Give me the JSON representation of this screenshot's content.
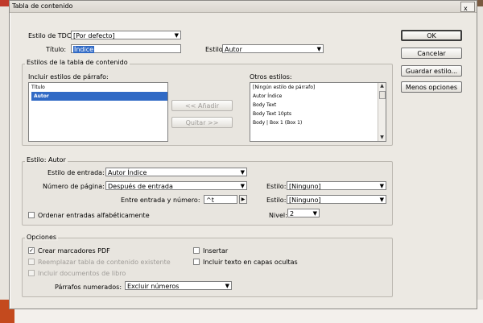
{
  "window": {
    "title": "Tabla de contenido",
    "close_glyph": "x"
  },
  "top": {
    "estilo_tdc_label": "Estilo de TDC:",
    "estilo_tdc_value": "[Por defecto]",
    "titulo_label": "Título:",
    "titulo_value": "Índice",
    "estilo_label": "Estilo:",
    "estilo_value": "Autor"
  },
  "buttons": {
    "ok": "OK",
    "cancel": "Cancelar",
    "save": "Guardar estilo...",
    "fewer": "Menos opciones",
    "add": "<< Añadir",
    "remove": "Quitar >>"
  },
  "estilos_group": {
    "title": "Estilos de la tabla de contenido",
    "incluir_label": "Incluir estilos de párrafo:",
    "incluir_items": [
      "Título",
      "Autor"
    ],
    "incluir_selected": "Autor",
    "otros_label": "Otros estilos:",
    "otros_items": [
      "[Ningún estilo de párrafo]",
      "Autor Índice",
      "Body Text",
      "Body Text 10pts",
      "Body | Box 1 (Box 1)"
    ]
  },
  "autor_group": {
    "title": "Estilo: Autor",
    "entrada_label": "Estilo de entrada:",
    "entrada_value": "Autor Índice",
    "pagina_label": "Número de página:",
    "pagina_value": "Después de entrada",
    "estilo1_label": "Estilo:",
    "estilo1_value": "[Ninguno]",
    "entre_label": "Entre entrada y número:",
    "entre_value": "^t",
    "estilo2_label": "Estilo:",
    "estilo2_value": "[Ninguno]",
    "ordenar_label": "Ordenar entradas alfabéticamente",
    "nivel_label": "Nivel:",
    "nivel_value": "2"
  },
  "opciones_group": {
    "title": "Opciones",
    "pdf_label": "Crear marcadores PDF",
    "pdf_checked": true,
    "reemplazar_label": "Reemplazar tabla de contenido existente",
    "incluir_docs_label": "Incluir documentos de libro",
    "insertar_label": "Insertar",
    "ocultas_label": "Incluir texto en capas ocultas",
    "parrafos_label": "Párrafos numerados:",
    "parrafos_value": "Excluir números"
  }
}
